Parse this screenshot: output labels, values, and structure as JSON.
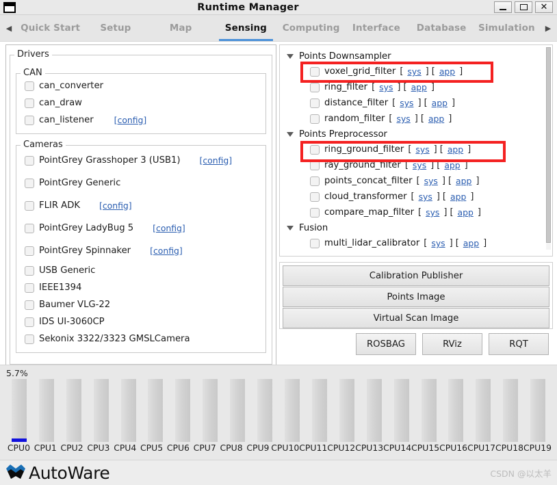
{
  "window": {
    "title": "Runtime Manager",
    "icon": "window-icon",
    "minimize_label": "–",
    "maximize_label": "□",
    "close_label": "✕"
  },
  "tabbar": {
    "prev_arrow": "◀",
    "next_arrow": "▶",
    "tabs": [
      {
        "label": "Quick Start",
        "active": false
      },
      {
        "label": "Setup",
        "active": false
      },
      {
        "label": "Map",
        "active": false
      },
      {
        "label": "Sensing",
        "active": true
      },
      {
        "label": "Computing",
        "active": false
      },
      {
        "label": "Interface",
        "active": false
      },
      {
        "label": "Database",
        "active": false
      },
      {
        "label": "Simulation",
        "active": false
      }
    ],
    "accent_color": "#4a90d9"
  },
  "drivers": {
    "title": "Drivers",
    "can": {
      "title": "CAN",
      "items": [
        {
          "label": "can_converter",
          "config": ""
        },
        {
          "label": "can_draw",
          "config": ""
        },
        {
          "label": "can_listener",
          "config": "[config]"
        }
      ]
    },
    "cameras": {
      "title": "Cameras",
      "items": [
        {
          "label": "PointGrey Grasshoper 3 (USB1)",
          "config": "[config]"
        },
        {
          "label": "PointGrey Generic",
          "config": ""
        },
        {
          "label": "FLIR ADK",
          "config": "[config]"
        },
        {
          "label": "PointGrey LadyBug 5",
          "config": "[config]"
        },
        {
          "label": "PointGrey Spinnaker",
          "config": "[config]"
        },
        {
          "label": "USB Generic",
          "config": ""
        },
        {
          "label": "IEEE1394",
          "config": ""
        },
        {
          "label": "Baumer VLG-22",
          "config": ""
        },
        {
          "label": "IDS UI-3060CP",
          "config": ""
        },
        {
          "label": "Sekonix 3322/3323 GMSLCamera",
          "config": ""
        }
      ]
    }
  },
  "tree": {
    "sys_label": "sys",
    "app_label": "app",
    "bracket_open": "[",
    "bracket_close": "]",
    "groups": [
      {
        "label": "Points Downsampler",
        "items": [
          {
            "label": "voxel_grid_filter",
            "highlighted": true
          },
          {
            "label": "ring_filter",
            "highlighted": false
          },
          {
            "label": "distance_filter",
            "highlighted": false
          },
          {
            "label": "random_filter",
            "highlighted": false
          }
        ]
      },
      {
        "label": "Points Preprocessor",
        "items": [
          {
            "label": "ring_ground_filter",
            "highlighted": true
          },
          {
            "label": "ray_ground_filter",
            "highlighted": false
          },
          {
            "label": "points_concat_filter",
            "highlighted": false
          },
          {
            "label": "cloud_transformer",
            "highlighted": false
          },
          {
            "label": "compare_map_filter",
            "highlighted": false
          }
        ]
      },
      {
        "label": "Fusion",
        "items": [
          {
            "label": "multi_lidar_calibrator",
            "highlighted": false
          }
        ]
      }
    ],
    "highlight_color": "#f42121"
  },
  "action_buttons": {
    "wide": [
      {
        "label": "Calibration Publisher"
      },
      {
        "label": "Points Image"
      },
      {
        "label": "Virtual Scan Image"
      }
    ],
    "small": [
      {
        "label": "ROSBAG"
      },
      {
        "label": "RViz"
      },
      {
        "label": "RQT"
      }
    ]
  },
  "cpu_monitor": {
    "percent_label": "5.7%",
    "fill_color": "#1010dd",
    "cores": [
      {
        "label": "CPU0",
        "value": 5.7
      },
      {
        "label": "CPU1",
        "value": 0
      },
      {
        "label": "CPU2",
        "value": 0
      },
      {
        "label": "CPU3",
        "value": 0
      },
      {
        "label": "CPU4",
        "value": 0
      },
      {
        "label": "CPU5",
        "value": 0
      },
      {
        "label": "CPU6",
        "value": 0
      },
      {
        "label": "CPU7",
        "value": 0
      },
      {
        "label": "CPU8",
        "value": 0
      },
      {
        "label": "CPU9",
        "value": 0
      },
      {
        "label": "CPU10",
        "value": 0
      },
      {
        "label": "CPU11",
        "value": 0
      },
      {
        "label": "CPU12",
        "value": 0
      },
      {
        "label": "CPU13",
        "value": 0
      },
      {
        "label": "CPU14",
        "value": 0
      },
      {
        "label": "CPU15",
        "value": 0
      },
      {
        "label": "CPU16",
        "value": 0
      },
      {
        "label": "CPU17",
        "value": 0
      },
      {
        "label": "CPU18",
        "value": 0
      },
      {
        "label": "CPU19",
        "value": 0
      }
    ]
  },
  "footer": {
    "logo_text": "AutoWare",
    "logo_icon": "autoware-logo-icon",
    "watermark": "CSDN @以太羊"
  }
}
